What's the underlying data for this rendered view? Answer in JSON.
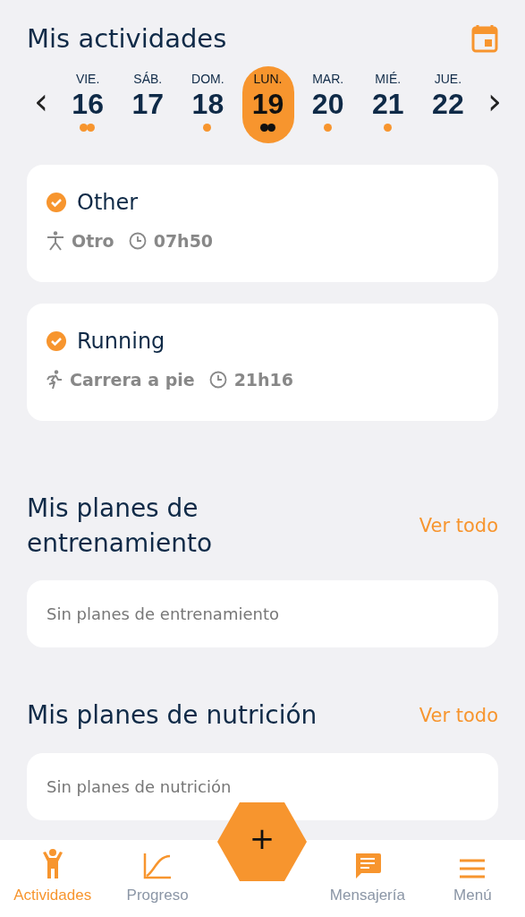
{
  "header": {
    "title": "Mis actividades"
  },
  "week": {
    "prev": "‹",
    "next": "›",
    "days": [
      {
        "weekday": "VIE.",
        "day": "16",
        "selected": false,
        "dots": [
          {
            "kind": "activity"
          },
          {
            "kind": "activity"
          }
        ]
      },
      {
        "weekday": "SÁB.",
        "day": "17",
        "selected": false
      },
      {
        "weekday": "DOM.",
        "day": "18",
        "selected": false,
        "dots": [
          {
            "kind": "activity"
          }
        ]
      },
      {
        "weekday": "LUN.",
        "day": "19",
        "selected": true,
        "dots": [
          {
            "kind": "activity"
          },
          {
            "kind": "activity"
          }
        ]
      },
      {
        "weekday": "MAR.",
        "day": "20",
        "selected": false,
        "dots": [
          {
            "kind": "activity"
          }
        ]
      },
      {
        "weekday": "MIÉ.",
        "day": "21",
        "selected": false,
        "dots": [
          {
            "kind": "activity"
          }
        ]
      },
      {
        "weekday": "JUE.",
        "day": "22",
        "selected": false
      }
    ]
  },
  "activities": [
    {
      "title": "Other",
      "done": true,
      "kind": "other",
      "sport": "Otro",
      "time": "07h50"
    },
    {
      "title": "Running",
      "done": true,
      "kind": "running",
      "sport": "Carrera a pie",
      "time": "21h16"
    }
  ],
  "sections": [
    {
      "title": "Mis planes de entrenamiento",
      "link": "Ver todo",
      "empty": "Sin planes de entrenamiento"
    },
    {
      "title": "Mis planes de nutrición",
      "link": "Ver todo",
      "empty": "Sin planes de nutrición"
    }
  ],
  "fab": "+",
  "nav": [
    {
      "label": "Actividades",
      "kind": "person",
      "selected": true
    },
    {
      "label": "Progreso",
      "kind": "chart",
      "selected": false
    },
    {
      "label": "Mensajería",
      "kind": "chat",
      "selected": false
    },
    {
      "label": "Menú",
      "kind": "menu",
      "selected": false
    }
  ]
}
